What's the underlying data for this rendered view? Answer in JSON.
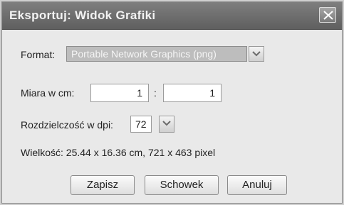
{
  "window": {
    "title": "Eksportuj: Widok Grafiki",
    "close_label": "×"
  },
  "format": {
    "label": "Format:",
    "value": "Portable Network Graphics (png)"
  },
  "scale": {
    "label": "Miara w cm:",
    "left_value": "1",
    "separator": ":",
    "right_value": "1"
  },
  "resolution": {
    "label": "Rozdzielczość w dpi:",
    "value": "72"
  },
  "size_info": {
    "text": "Wielkość: 25.44 x 16.36 cm, 721 x 463 pixel"
  },
  "buttons": {
    "save": "Zapisz",
    "clipboard": "Schowek",
    "cancel": "Anuluj"
  }
}
